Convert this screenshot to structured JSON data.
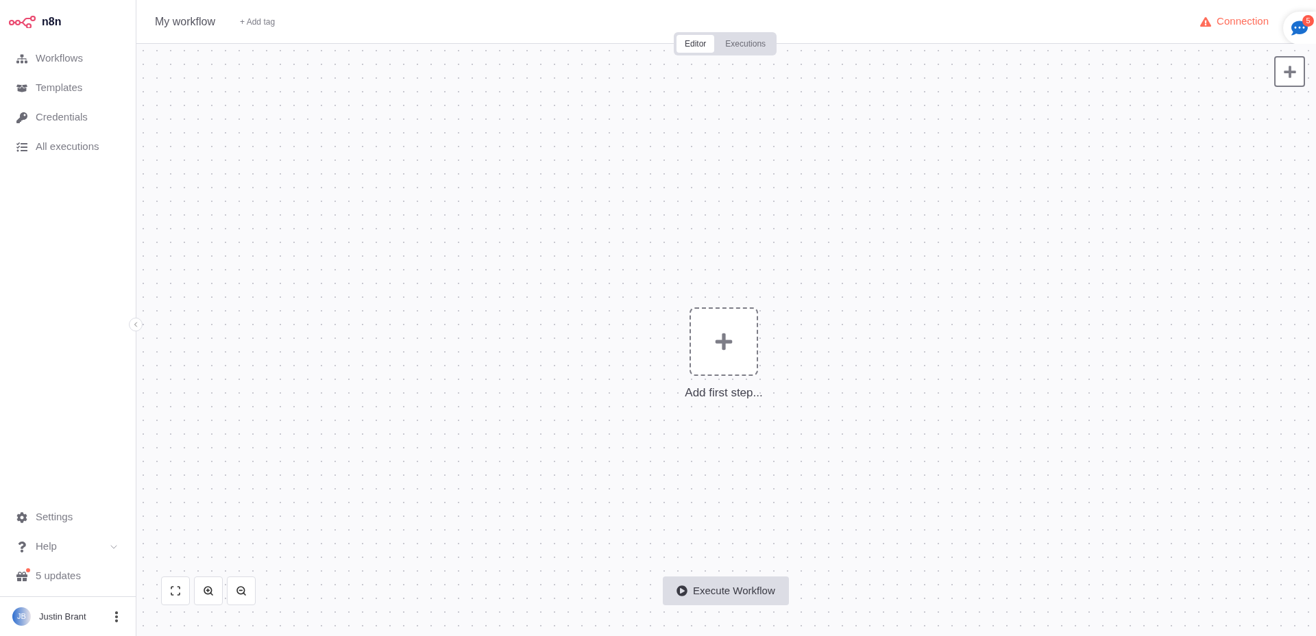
{
  "logo": {
    "text": "n8n"
  },
  "sidebar": {
    "items": [
      {
        "label": "Workflows",
        "kind": "workflows"
      },
      {
        "label": "Templates",
        "kind": "templates"
      },
      {
        "label": "Credentials",
        "kind": "credentials"
      },
      {
        "label": "All executions",
        "kind": "executions"
      }
    ],
    "bottom_items": [
      {
        "label": "Settings",
        "kind": "settings",
        "expandable": false,
        "notification": false
      },
      {
        "label": "Help",
        "kind": "help",
        "expandable": true,
        "notification": false
      },
      {
        "label": "5 updates",
        "kind": "updates",
        "expandable": false,
        "notification": true
      }
    ],
    "user": {
      "initials": "JB",
      "name": "Justin Brant"
    }
  },
  "header": {
    "workflow_name": "My workflow",
    "add_tag": "+ Add tag",
    "connection_status": "Connection",
    "chat_badge": "5"
  },
  "view_tabs": [
    {
      "label": "Editor",
      "selected": true
    },
    {
      "label": "Executions",
      "selected": false
    }
  ],
  "canvas": {
    "add_first_step": "Add first step...",
    "execute_button": "Execute Workflow"
  }
}
